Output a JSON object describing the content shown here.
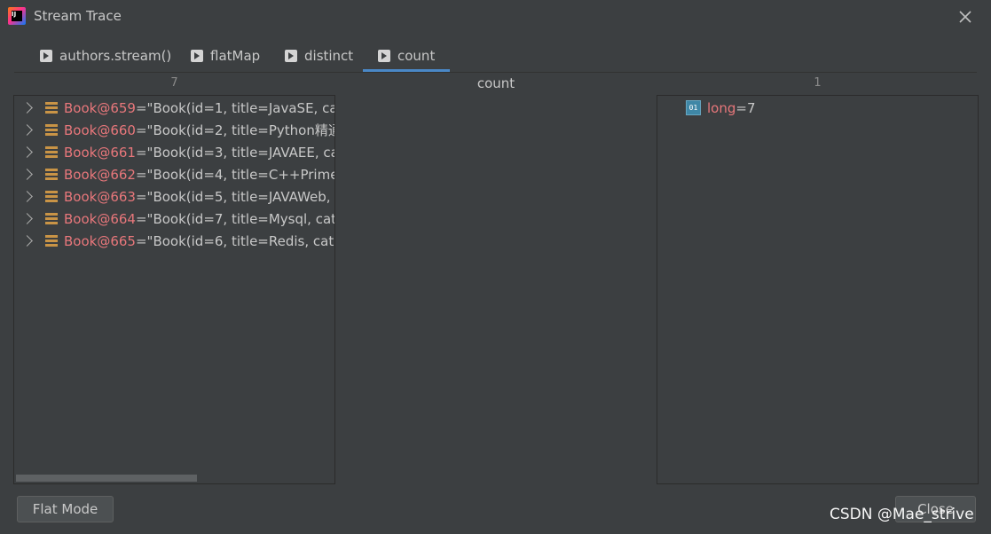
{
  "window": {
    "title": "Stream Trace"
  },
  "tabs": [
    {
      "label": "authors.stream()",
      "icon": "stream-op-icon"
    },
    {
      "label": "flatMap",
      "icon": "stream-op-icon"
    },
    {
      "label": "distinct",
      "icon": "stream-op-icon"
    },
    {
      "label": "count",
      "icon": "stream-op-icon",
      "active": true
    }
  ],
  "columns": {
    "left_count": "7",
    "middle_title": "count",
    "right_count": "1"
  },
  "left_items": [
    {
      "name": "Book@659",
      "eq": " = ",
      "value": "\"Book(id=1, title=JavaSE, cat"
    },
    {
      "name": "Book@660",
      "eq": " = ",
      "value": "\"Book(id=2, title=Python精通"
    },
    {
      "name": "Book@661",
      "eq": " = ",
      "value": "\"Book(id=3, title=JAVAEE, ca"
    },
    {
      "name": "Book@662",
      "eq": " = ",
      "value": "\"Book(id=4, title=C++Prime,"
    },
    {
      "name": "Book@663",
      "eq": " = ",
      "value": "\"Book(id=5, title=JAVAWeb,"
    },
    {
      "name": "Book@664",
      "eq": " = ",
      "value": "\"Book(id=7, title=Mysql, cate"
    },
    {
      "name": "Book@665",
      "eq": " = ",
      "value": "\"Book(id=6, title=Redis, cate"
    }
  ],
  "right_items": [
    {
      "icon_text": "01",
      "name": "long",
      "eq": " = ",
      "value": "7"
    }
  ],
  "buttons": {
    "flat_mode": "Flat Mode",
    "close": "Close"
  },
  "watermark": "CSDN @Mae_strive",
  "colors": {
    "accent": "#4a88c7",
    "object_name": "#e8777b",
    "background": "#3c3f41"
  }
}
